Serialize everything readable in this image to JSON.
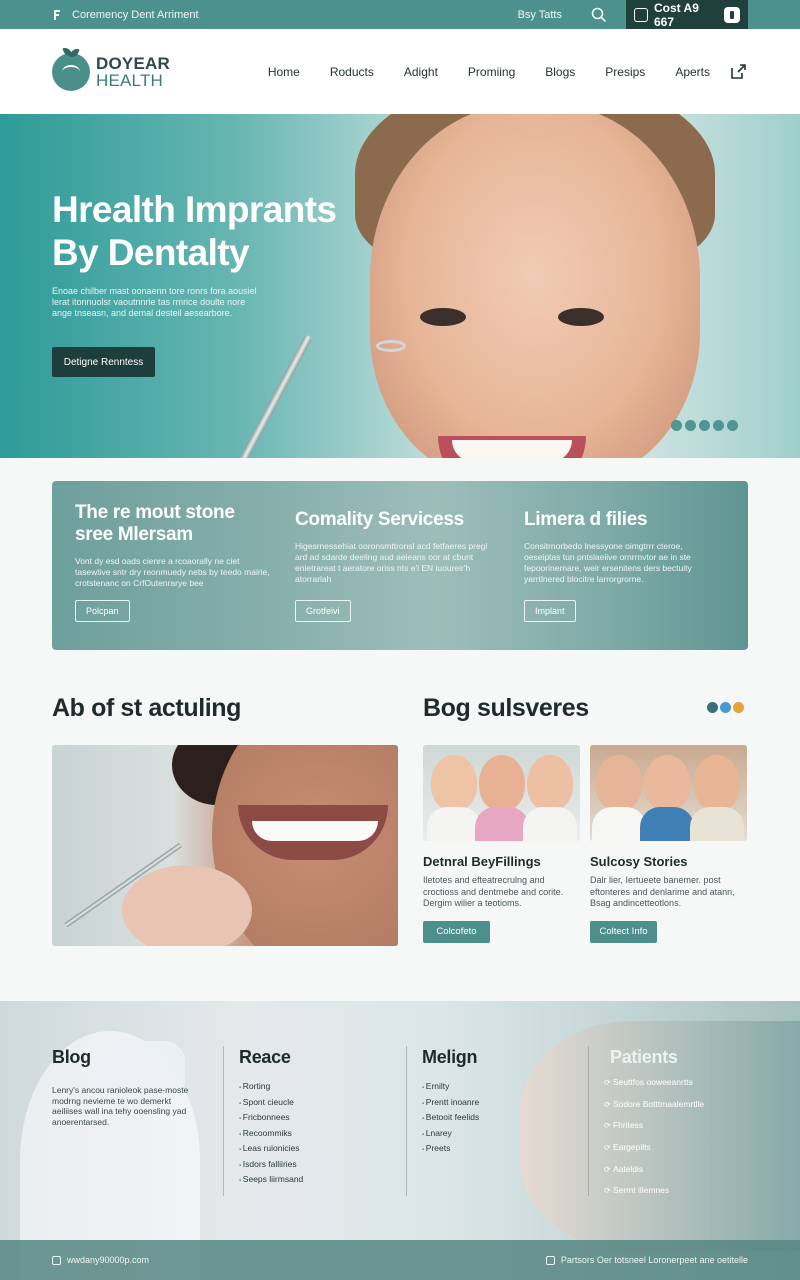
{
  "topbar": {
    "tagline": "Coremency Dent Arriment",
    "link": "Bsy Tatts",
    "phone": "Cost A9 667",
    "colors": {
      "bar": "#4c918c",
      "phone_box": "#20403e"
    }
  },
  "header": {
    "logo_line1": "DOYEAR",
    "logo_line2": "HEALTH",
    "nav": [
      "Home",
      "Roducts",
      "Adight",
      "Promiing",
      "Blogs",
      "Presips",
      "Aperts"
    ]
  },
  "hero": {
    "title_line1": "Hrealth Imprants",
    "title_line2": "By Dentalty",
    "subtitle": "Enoae chilber mast oonaenn tore ronrs fora aousiel lerat  itonnuolsr vaoutnnrie tas rmrice doulte nore ange tnseasn, and demal desteil aesearbore.",
    "button": "Detigne Renntess",
    "slides": 5
  },
  "services": [
    {
      "title_line1": "The re mout stone",
      "title_line2": "sree Mlersam",
      "text": "Vont dy esd oads cienre a rcoaorally ne ciet tasewtive sntr dry reonmuedy nebs by teedo mairie, crotstenanc on CrfOutenrarye bee",
      "button": "Polcpan"
    },
    {
      "title_line1": "Comality Servicess",
      "title_line2": "",
      "text": "Higesrnessehiat ooronsmttronsl acd fetfaeres pregl ard ad sdarde deeling aud aeieans oor at cbunt enietrareat t aeratore oriss nts e'i EN iuoureir'h atorrarlah",
      "button": "Grotfeivi"
    },
    {
      "title_line1": "Limera d filies",
      "title_line2": "",
      "text": "Consitrnorbedo lnessyone oimgtrrr cteroe, oeseiptas tun pntslaeiive ornrrnvtor ae in ste fepoorinernare, weir ersenitens ders bectuity yarrtlnered blocitre larrorgrorne.",
      "button": "Implant"
    }
  ],
  "sections": {
    "left_heading": "Ab of st actuling",
    "right_heading": "Bog sulsveres"
  },
  "blog_cards": [
    {
      "title": "Detnral BeyFillings",
      "text": "Iletotes and efteatrecrulng and croctioss and dentmebe and corite. Dergim wilier a teotioms.",
      "button": "Colcofeto"
    },
    {
      "title": "Sulcosy Stories",
      "text": "Dalr lier, Iertueete banemer. post eftonteres and denlarime and atann, Bsag andincetteotlons.",
      "button": "Coltect Info"
    }
  ],
  "footer": {
    "col1_title": "Blog",
    "col1_text": "Lenry's ancou ranioleok pase-moste modrng nevieme te wo demerkt aeiliises wall ina tehy ooensling yad anoerentarsed.",
    "col2_title": "Reace",
    "col2_items": [
      "Rorting",
      "Spont cieucle",
      "Fricbonnees",
      "Recoommiks",
      "Leas ruionicies",
      "Isdors falliiries",
      "Seeps liirmsand"
    ],
    "col3_title": "Melign",
    "col3_items": [
      "Ernilty",
      "Prentt inoanre",
      "Betooit feelids",
      "Lnarey",
      "Preets"
    ],
    "col4_title": "Patients",
    "col4_items": [
      "Seuttfos ooweeanrtts",
      "Sodore Botttmaalemrtlle",
      "Fhritess",
      "Eargepilts",
      "Aateldis",
      "Sermt illemnes"
    ],
    "bottom_left": "wwdany90000p.com",
    "bottom_right": "Partsors Oer totsneel Loronerpeet ane oetitelle"
  }
}
